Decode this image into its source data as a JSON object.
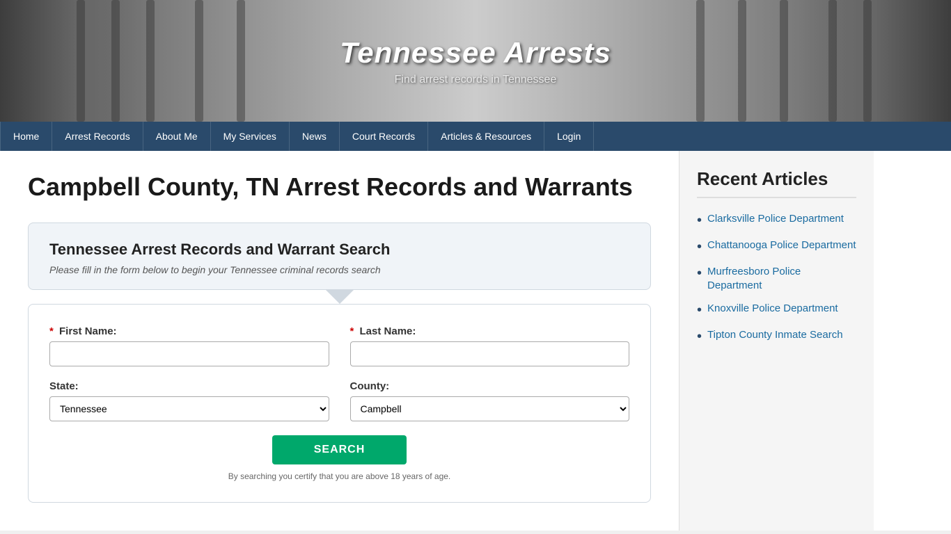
{
  "site": {
    "title": "Tennessee Arrests",
    "subtitle": "Find arrest records in Tennessee"
  },
  "nav": {
    "items": [
      {
        "label": "Home",
        "active": false
      },
      {
        "label": "Arrest Records",
        "active": false
      },
      {
        "label": "About Me",
        "active": false
      },
      {
        "label": "My Services",
        "active": false
      },
      {
        "label": "News",
        "active": false
      },
      {
        "label": "Court Records",
        "active": false
      },
      {
        "label": "Articles & Resources",
        "active": false
      },
      {
        "label": "Login",
        "active": false
      }
    ]
  },
  "page": {
    "title": "Campbell County, TN Arrest Records and Warrants"
  },
  "search_box": {
    "title": "Tennessee Arrest Records and Warrant Search",
    "subtitle": "Please fill in the form below to begin your Tennessee criminal records search"
  },
  "form": {
    "first_name_label": "First Name:",
    "last_name_label": "Last Name:",
    "state_label": "State:",
    "county_label": "County:",
    "required_mark": "*",
    "state_value": "Tennessee",
    "county_value": "Campbell",
    "search_button": "SEARCH",
    "disclaimer": "By searching you certify that you are above 18 years of age."
  },
  "sidebar": {
    "title": "Recent Articles",
    "articles": [
      {
        "label": "Clarksville Police Department"
      },
      {
        "label": "Chattanooga Police Department"
      },
      {
        "label": "Murfreesboro Police Department"
      },
      {
        "label": "Knoxville Police Department"
      },
      {
        "label": "Tipton County Inmate Search"
      }
    ]
  },
  "bars": [
    110,
    160,
    210,
    280,
    340,
    1000,
    1060,
    1120,
    1190,
    1240
  ]
}
